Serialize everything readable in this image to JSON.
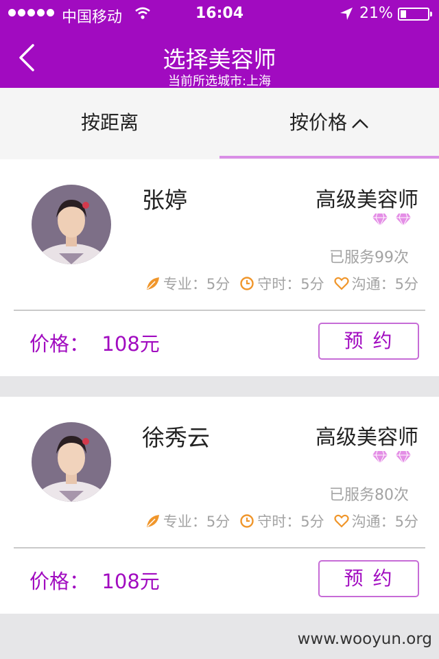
{
  "status_bar": {
    "carrier": "中国移动",
    "time": "16:04",
    "battery_percent": "21%",
    "battery_level": 0.21,
    "icons": [
      "signal-dots-icon",
      "wifi-icon",
      "location-arrow-icon",
      "battery-icon"
    ]
  },
  "header": {
    "back_icon": "chevron-left-icon",
    "title": "选择美容师",
    "subtitle": "当前所选城市:上海"
  },
  "tabs": {
    "distance": "按距离",
    "price": "按价格",
    "active": "price",
    "price_sort_icon": "chevron-up-icon"
  },
  "colors": {
    "brand": "#a10bc0",
    "accent_light": "#d98ee6",
    "diamond": "#e48ee6",
    "rating_icon": "#f0962b"
  },
  "beauticians": [
    {
      "name": "张婷",
      "level": "高级美容师",
      "diamonds": 2,
      "served": "已服务99次",
      "ratings": [
        {
          "icon": "leaf-icon",
          "label": "专业：",
          "value": "5分"
        },
        {
          "icon": "clock-icon",
          "label": "守时：",
          "value": "5分"
        },
        {
          "icon": "heart-icon",
          "label": "沟通：",
          "value": "5分"
        }
      ],
      "price": "价格：  108元",
      "book_label": "预约"
    },
    {
      "name": "徐秀云",
      "level": "高级美容师",
      "diamonds": 2,
      "served": "已服务80次",
      "ratings": [
        {
          "icon": "leaf-icon",
          "label": "专业：",
          "value": "5分"
        },
        {
          "icon": "clock-icon",
          "label": "守时：",
          "value": "5分"
        },
        {
          "icon": "heart-icon",
          "label": "沟通：",
          "value": "5分"
        }
      ],
      "price": "价格：  108元",
      "book_label": "预约"
    }
  ],
  "watermark": "www.wooyun.org"
}
